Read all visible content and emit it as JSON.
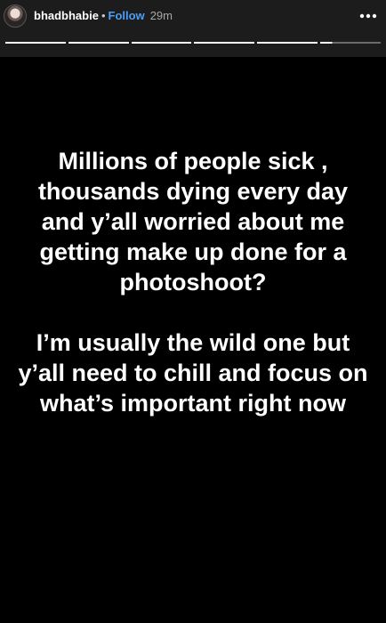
{
  "header": {
    "username": "bhadbhabie",
    "separator": "•",
    "follow_label": "Follow",
    "time_ago": "29m"
  },
  "progress": {
    "segments": 6,
    "current_segment_fraction": 0.2
  },
  "story": {
    "paragraph1": "Millions of people sick , thousands dying every day and y’all worried about me getting make up done for a photoshoot?",
    "paragraph2": "I’m usually the wild one but y’all need to chill and focus on what’s important right now"
  },
  "icons": {
    "avatar": "profile-avatar",
    "more": "more-dots-icon"
  }
}
